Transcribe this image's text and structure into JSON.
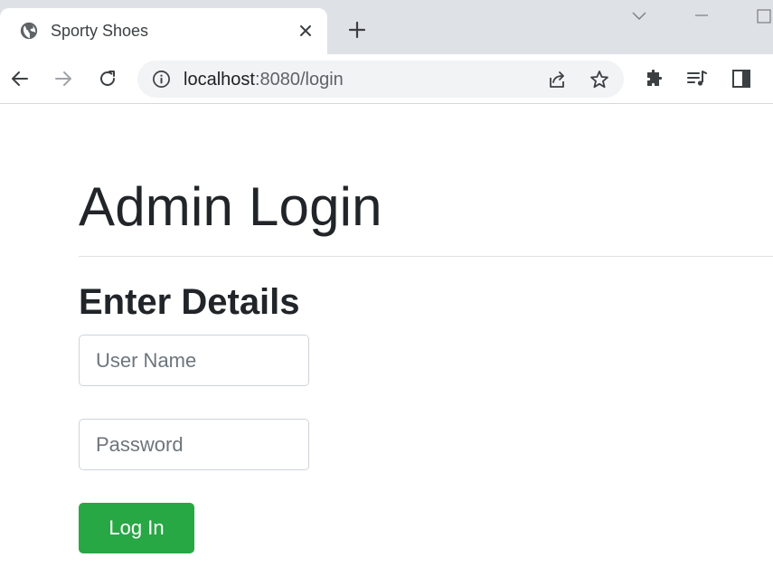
{
  "browser": {
    "tab": {
      "title": "Sporty Shoes"
    },
    "url": {
      "host": "localhost",
      "rest": ":8080/login"
    },
    "icons": [
      "globe-icon",
      "close-icon",
      "plus-icon",
      "chevron-down-icon",
      "minimize-icon",
      "maximize-icon",
      "back-arrow-icon",
      "forward-arrow-icon",
      "reload-icon",
      "info-icon",
      "share-icon",
      "star-icon",
      "extensions-icon",
      "media-queue-icon",
      "side-panel-icon"
    ]
  },
  "page": {
    "title": "Admin Login",
    "section_title": "Enter Details",
    "username": {
      "placeholder": "User Name",
      "value": ""
    },
    "password": {
      "placeholder": "Password",
      "value": ""
    },
    "login_label": "Log In"
  },
  "colors": {
    "button": "#28a745",
    "tabstrip": "#dee1e6",
    "omnibox": "#f1f3f4"
  }
}
